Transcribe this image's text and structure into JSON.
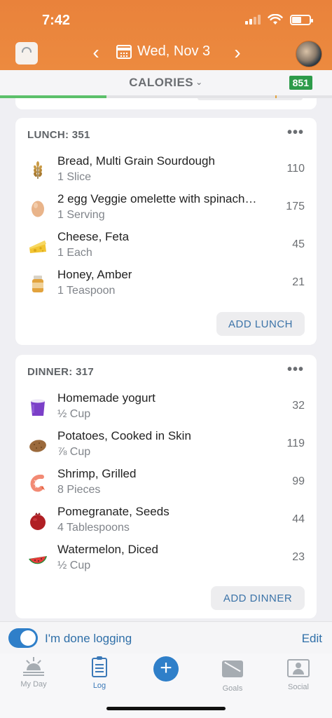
{
  "status_bar": {
    "time": "7:42"
  },
  "header": {
    "date": "Wed, Nov 3",
    "prev_icon": "chevron-left-icon",
    "next_icon": "chevron-right-icon",
    "scale_icon": "scale-icon",
    "calendar_icon": "calendar-icon"
  },
  "calories_bar": {
    "label": "CALORIES",
    "remaining": "851",
    "progress_fraction": 0.32,
    "colors": {
      "progress": "#5cc06a",
      "badge": "#2d9b4a"
    }
  },
  "meals": [
    {
      "title": "LUNCH: 351",
      "menu": "•••",
      "add_label": "ADD LUNCH",
      "items": [
        {
          "name": "Bread, Multi Grain Sourdough",
          "serving": "1 Slice",
          "calories": "110",
          "icon": "wheat-icon"
        },
        {
          "name": "2 egg Veggie omelette with spinach…",
          "serving": "1 Serving",
          "calories": "175",
          "icon": "egg-icon"
        },
        {
          "name": "Cheese, Feta",
          "serving": "1 Each",
          "calories": "45",
          "icon": "cheese-icon"
        },
        {
          "name": "Honey, Amber",
          "serving": "1 Teaspoon",
          "calories": "21",
          "icon": "honey-jar-icon"
        }
      ]
    },
    {
      "title": "DINNER: 317",
      "menu": "•••",
      "add_label": "ADD DINNER",
      "items": [
        {
          "name": "Homemade yogurt",
          "serving": "½ Cup",
          "calories": "32",
          "icon": "yogurt-cup-icon"
        },
        {
          "name": "Potatoes, Cooked in Skin",
          "serving": "⅞ Cup",
          "calories": "119",
          "icon": "potato-icon"
        },
        {
          "name": "Shrimp, Grilled",
          "serving": "8 Pieces",
          "calories": "99",
          "icon": "shrimp-icon"
        },
        {
          "name": "Pomegranate, Seeds",
          "serving": "4 Tablespoons",
          "calories": "44",
          "icon": "pomegranate-icon"
        },
        {
          "name": "Watermelon, Diced",
          "serving": "½ Cup",
          "calories": "23",
          "icon": "watermelon-icon"
        }
      ]
    }
  ],
  "done_bar": {
    "label": "I'm done logging",
    "edit": "Edit",
    "toggle_on": true
  },
  "tabs": [
    {
      "label": "My Day",
      "icon": "sunrise-icon"
    },
    {
      "label": "Log",
      "icon": "clipboard-icon",
      "active": true
    },
    {
      "label": "",
      "icon": "plus-icon"
    },
    {
      "label": "Goals",
      "icon": "goals-icon"
    },
    {
      "label": "Social",
      "icon": "social-icon"
    }
  ]
}
